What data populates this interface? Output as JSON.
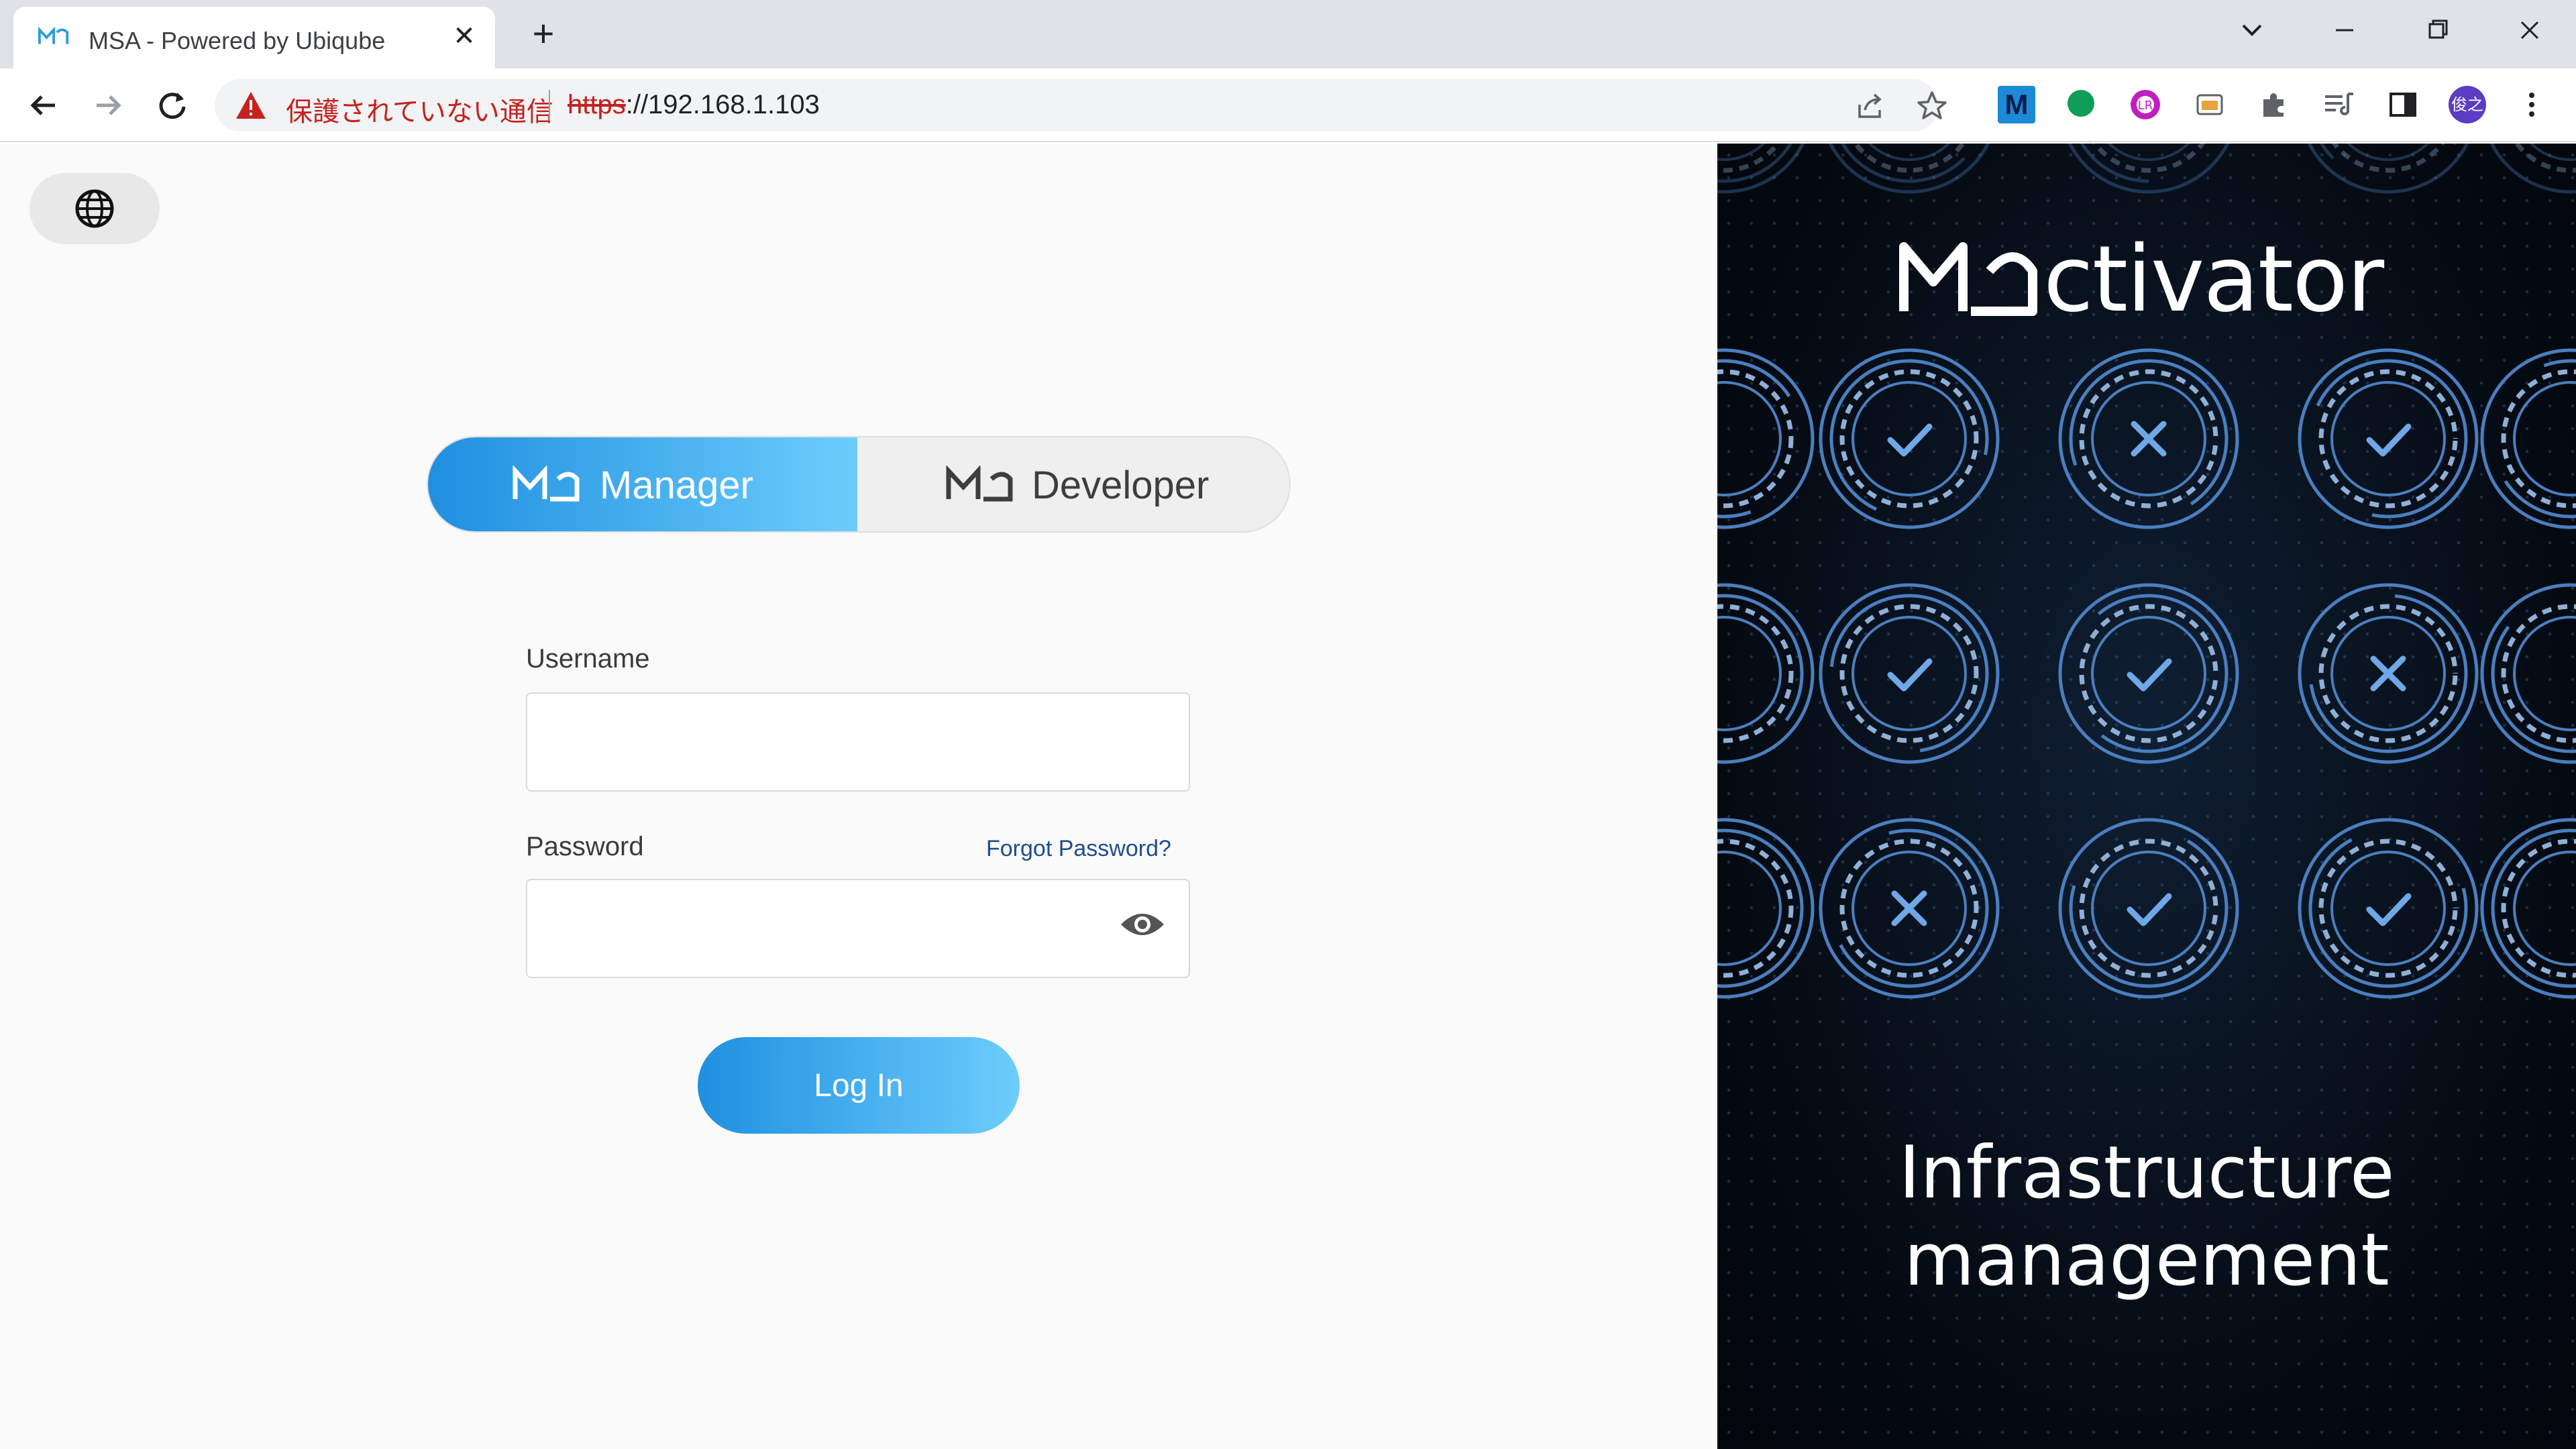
{
  "browser": {
    "tab_title": "MSA - Powered by Ubiqube",
    "security_label": "保護されていない通信",
    "url_scheme": "https",
    "url_rest": "://192.168.1.103",
    "profile_initials": "俊之",
    "extension_m_label": "M"
  },
  "language_button": {
    "icon": "globe-icon"
  },
  "role_switch": {
    "manager_label": "Manager",
    "developer_label": "Developer",
    "selected": "Manager"
  },
  "form": {
    "username_label": "Username",
    "username_value": "",
    "password_label": "Password",
    "password_value": "",
    "forgot_password": "Forgot Password?",
    "login_button": "Log In"
  },
  "promo": {
    "brand": "ctivator",
    "tagline_line1": "Infrastructure",
    "tagline_line2": "management"
  },
  "colors": {
    "accent_start": "#1f8fe0",
    "accent_end": "#6dcdfc",
    "promo_bg": "#050a12",
    "ring_color": "#4a7fbf",
    "warning_red": "#c5221f"
  }
}
